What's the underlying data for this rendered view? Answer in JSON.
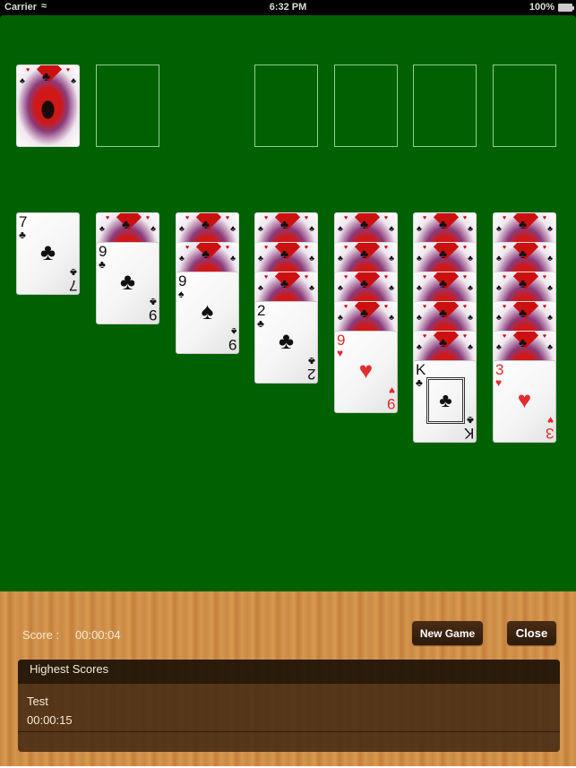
{
  "status_bar": {
    "carrier": "Carrier",
    "wifi_icon": "wifi-icon",
    "time": "6:32 PM",
    "battery": "100%"
  },
  "game": {
    "stock": {
      "state": "face-down"
    },
    "waste": {
      "state": "empty"
    },
    "foundations": [
      {
        "state": "empty"
      },
      {
        "state": "empty"
      },
      {
        "state": "empty"
      },
      {
        "state": "empty"
      }
    ],
    "tableau": [
      {
        "hidden": 0,
        "face_up": [
          {
            "rank": "7",
            "suit": "♣",
            "color": "black"
          }
        ]
      },
      {
        "hidden": 1,
        "face_up": [
          {
            "rank": "9",
            "suit": "♣",
            "color": "black"
          }
        ]
      },
      {
        "hidden": 2,
        "face_up": [
          {
            "rank": "9",
            "suit": "♠",
            "color": "black"
          }
        ]
      },
      {
        "hidden": 3,
        "face_up": [
          {
            "rank": "2",
            "suit": "♣",
            "color": "black"
          }
        ]
      },
      {
        "hidden": 4,
        "face_up": [
          {
            "rank": "9",
            "suit": "♥",
            "color": "red"
          }
        ]
      },
      {
        "hidden": 5,
        "face_up": [
          {
            "rank": "K",
            "suit": "♣",
            "color": "black"
          }
        ]
      },
      {
        "hidden": 5,
        "face_up": [
          {
            "rank": "3",
            "suit": "♥",
            "color": "red"
          }
        ]
      }
    ],
    "colors": {
      "felt": "#006100",
      "red_suit": "#e22c2c"
    }
  },
  "panel": {
    "score_label": "Score :",
    "score_value": "00:00:04",
    "new_game_label": "New Game",
    "close_label": "Close",
    "highest_scores_title": "Highest Scores",
    "highest_scores": [
      {
        "name": "Test",
        "time": "00:00:15"
      }
    ]
  }
}
